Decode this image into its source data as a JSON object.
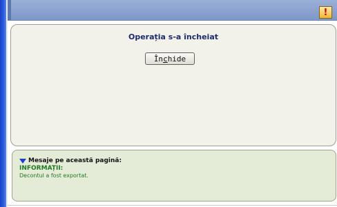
{
  "header": {
    "icon": "exclamation-icon"
  },
  "dialog": {
    "title": "Operația s-a încheiat",
    "close_button": {
      "label": "Închide",
      "underline_char": "c"
    }
  },
  "messages": {
    "header": "Mesaje pe această pagină:",
    "label": "INFORMAȚII:",
    "text": "Decontul a fost exportat."
  },
  "colors": {
    "header_bar": "#8aa1cf",
    "panel_bg": "#f2f1ea",
    "messages_bg": "#e4ecd8",
    "info_text": "#1f7a1f",
    "title_text": "#1c2b6e"
  }
}
